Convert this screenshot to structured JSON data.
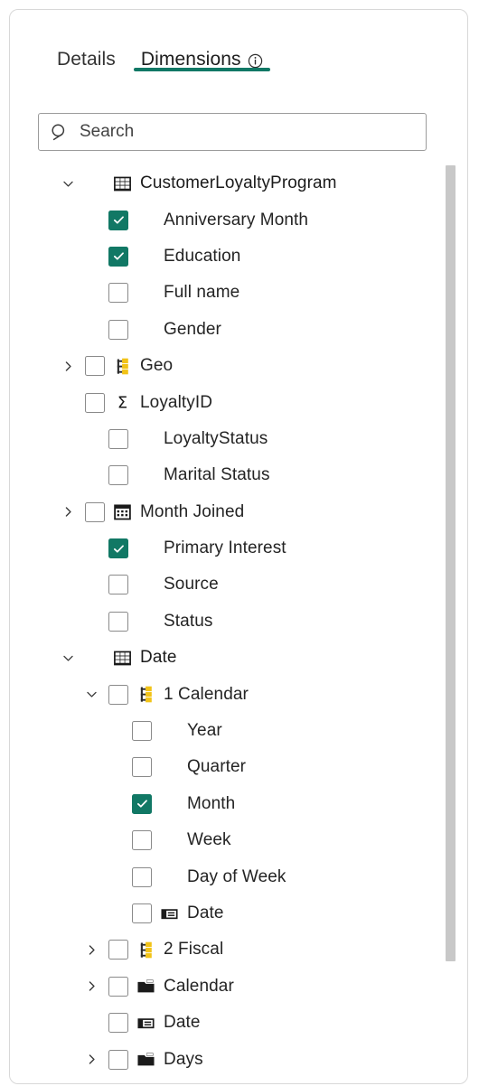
{
  "panel": {
    "tabs": [
      {
        "label": "Details",
        "active": false,
        "info": false
      },
      {
        "label": "Dimensions",
        "active": true,
        "info": true,
        "info_icon": "info-circle-icon"
      }
    ]
  },
  "search": {
    "placeholder": "Search",
    "value": "",
    "icon": "search-icon"
  },
  "colors": {
    "accent": "#117865",
    "checkbox_checked": "#117865",
    "hierarchy_icon": "#f2c317",
    "field_icon": "#1a1a1a",
    "border": "#d8d8d8",
    "scrollbar": "#c8c8c8"
  },
  "tree": {
    "scrollbar": {
      "visible": true
    },
    "items": [
      {
        "label": "CustomerLoyaltyProgram",
        "indent": 0,
        "chevron": "down",
        "checkbox": "none",
        "icon": "table-icon"
      },
      {
        "label": "Anniversary Month",
        "indent": 1,
        "chevron": "none",
        "checkbox": "checked",
        "icon": "none"
      },
      {
        "label": "Education",
        "indent": 1,
        "chevron": "none",
        "checkbox": "checked",
        "icon": "none"
      },
      {
        "label": "Full name",
        "indent": 1,
        "chevron": "none",
        "checkbox": "unchecked",
        "icon": "none"
      },
      {
        "label": "Gender",
        "indent": 1,
        "chevron": "none",
        "checkbox": "unchecked",
        "icon": "none"
      },
      {
        "label": "Geo",
        "indent": 0,
        "chevron": "right",
        "checkbox": "unchecked",
        "icon": "hierarchy-icon"
      },
      {
        "label": "LoyaltyID",
        "indent": 0,
        "chevron": "blank",
        "checkbox": "unchecked",
        "icon": "sigma-icon"
      },
      {
        "label": "LoyaltyStatus",
        "indent": 1,
        "chevron": "none",
        "checkbox": "unchecked",
        "icon": "none"
      },
      {
        "label": "Marital Status",
        "indent": 1,
        "chevron": "none",
        "checkbox": "unchecked",
        "icon": "none"
      },
      {
        "label": "Month Joined",
        "indent": 0,
        "chevron": "right",
        "checkbox": "unchecked",
        "icon": "calendar-icon"
      },
      {
        "label": "Primary Interest",
        "indent": 1,
        "chevron": "none",
        "checkbox": "checked",
        "icon": "none"
      },
      {
        "label": "Source",
        "indent": 1,
        "chevron": "none",
        "checkbox": "unchecked",
        "icon": "none"
      },
      {
        "label": "Status",
        "indent": 1,
        "chevron": "none",
        "checkbox": "unchecked",
        "icon": "none"
      },
      {
        "label": "Date",
        "indent": 0,
        "chevron": "down",
        "checkbox": "none",
        "icon": "table-icon"
      },
      {
        "label": "1 Calendar",
        "indent": 1,
        "chevron": "down",
        "checkbox": "unchecked",
        "icon": "hierarchy-icon"
      },
      {
        "label": "Year",
        "indent": 2,
        "chevron": "none",
        "checkbox": "unchecked",
        "icon": "none"
      },
      {
        "label": "Quarter",
        "indent": 2,
        "chevron": "none",
        "checkbox": "unchecked",
        "icon": "none"
      },
      {
        "label": "Month",
        "indent": 2,
        "chevron": "none",
        "checkbox": "checked",
        "icon": "none"
      },
      {
        "label": "Week",
        "indent": 2,
        "chevron": "none",
        "checkbox": "unchecked",
        "icon": "none"
      },
      {
        "label": "Day of Week",
        "indent": 2,
        "chevron": "none",
        "checkbox": "unchecked",
        "icon": "none"
      },
      {
        "label": "Date",
        "indent": 2,
        "chevron": "none",
        "checkbox": "unchecked",
        "icon": "field-icon"
      },
      {
        "label": "2 Fiscal",
        "indent": 1,
        "chevron": "right",
        "checkbox": "unchecked",
        "icon": "hierarchy-icon"
      },
      {
        "label": "Calendar",
        "indent": 1,
        "chevron": "right",
        "checkbox": "unchecked",
        "icon": "folder-icon"
      },
      {
        "label": "Date",
        "indent": 1,
        "chevron": "blank",
        "checkbox": "unchecked",
        "icon": "field-icon"
      },
      {
        "label": "Days",
        "indent": 1,
        "chevron": "right",
        "checkbox": "unchecked",
        "icon": "folder-icon"
      }
    ]
  }
}
